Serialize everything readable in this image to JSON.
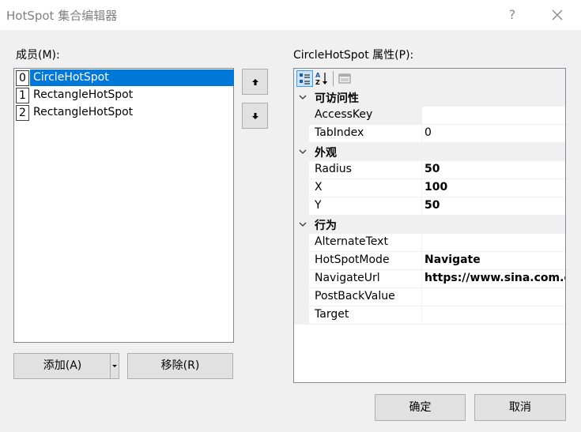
{
  "window": {
    "title": "HotSpot 集合编辑器",
    "help_glyph": "?"
  },
  "members": {
    "label": "成员(M):",
    "items": [
      {
        "index": "0",
        "name": "CircleHotSpot",
        "selected": true
      },
      {
        "index": "1",
        "name": "RectangleHotSpot",
        "selected": false
      },
      {
        "index": "2",
        "name": "RectangleHotSpot",
        "selected": false
      }
    ],
    "add_label": "添加(A)",
    "remove_label": "移除(R)"
  },
  "properties": {
    "label": "CircleHotSpot 属性(P):",
    "categories": [
      {
        "name": "可访问性",
        "props": [
          {
            "name": "AccessKey",
            "value": "",
            "bold": false
          },
          {
            "name": "TabIndex",
            "value": "0",
            "bold": false
          }
        ]
      },
      {
        "name": "外观",
        "props": [
          {
            "name": "Radius",
            "value": "50",
            "bold": true
          },
          {
            "name": "X",
            "value": "100",
            "bold": true
          },
          {
            "name": "Y",
            "value": "50",
            "bold": true
          }
        ]
      },
      {
        "name": "行为",
        "props": [
          {
            "name": "AlternateText",
            "value": "",
            "bold": false
          },
          {
            "name": "HotSpotMode",
            "value": "Navigate",
            "bold": true
          },
          {
            "name": "NavigateUrl",
            "value": "https://www.sina.com.c",
            "bold": true
          },
          {
            "name": "PostBackValue",
            "value": "",
            "bold": false
          },
          {
            "name": "Target",
            "value": "",
            "bold": false
          }
        ]
      }
    ]
  },
  "footer": {
    "ok_label": "确定",
    "cancel_label": "取消"
  },
  "colors": {
    "selection": "#0078d7",
    "toolbar_active": "#cce4f7"
  }
}
